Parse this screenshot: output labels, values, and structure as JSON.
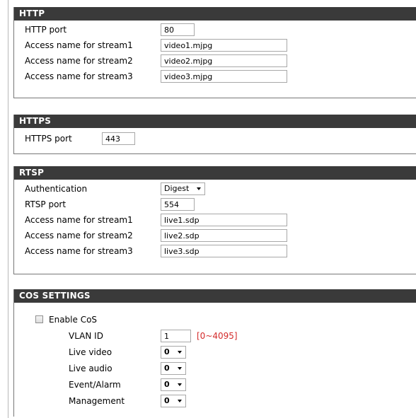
{
  "http": {
    "title": "HTTP",
    "port_label": "HTTP port",
    "port_value": "80",
    "stream1_label": "Access name for stream1",
    "stream1_value": "video1.mjpg",
    "stream2_label": "Access name for stream2",
    "stream2_value": "video2.mjpg",
    "stream3_label": "Access name for stream3",
    "stream3_value": "video3.mjpg"
  },
  "https": {
    "title": "HTTPS",
    "port_label": "HTTPS port",
    "port_value": "443"
  },
  "rtsp": {
    "title": "RTSP",
    "auth_label": "Authentication",
    "auth_value": "Digest",
    "port_label": "RTSP port",
    "port_value": "554",
    "stream1_label": "Access name for stream1",
    "stream1_value": "live1.sdp",
    "stream2_label": "Access name for stream2",
    "stream2_value": "live2.sdp",
    "stream3_label": "Access name for stream3",
    "stream3_value": "live3.sdp"
  },
  "cos": {
    "title": "COS SETTINGS",
    "enable_label": "Enable CoS",
    "enable_checked": false,
    "vlan_label": "VLAN ID",
    "vlan_value": "1",
    "vlan_range": "[0~4095]",
    "live_video_label": "Live video",
    "live_video_value": "0",
    "live_audio_label": "Live audio",
    "live_audio_value": "0",
    "event_alarm_label": "Event/Alarm",
    "event_alarm_value": "0",
    "management_label": "Management",
    "management_value": "0"
  }
}
